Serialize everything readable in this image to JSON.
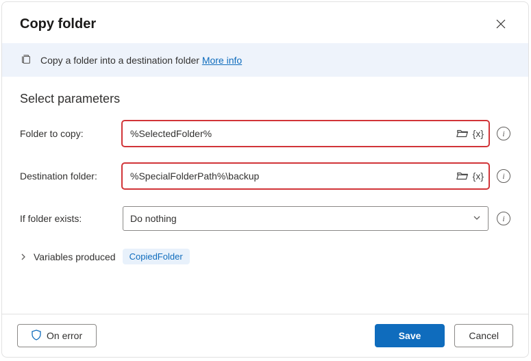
{
  "dialog": {
    "title": "Copy folder"
  },
  "banner": {
    "text": "Copy a folder into a destination folder ",
    "more_info": "More info"
  },
  "section": {
    "title": "Select parameters"
  },
  "fields": {
    "folder_to_copy": {
      "label": "Folder to copy:",
      "value": "%SelectedFolder%"
    },
    "destination_folder": {
      "label": "Destination folder:",
      "value": "%SpecialFolderPath%\\backup"
    },
    "if_exists": {
      "label": "If folder exists:",
      "value": "Do nothing"
    }
  },
  "variables": {
    "label": "Variables produced",
    "chip": "CopiedFolder"
  },
  "footer": {
    "on_error": "On error",
    "save": "Save",
    "cancel": "Cancel"
  }
}
